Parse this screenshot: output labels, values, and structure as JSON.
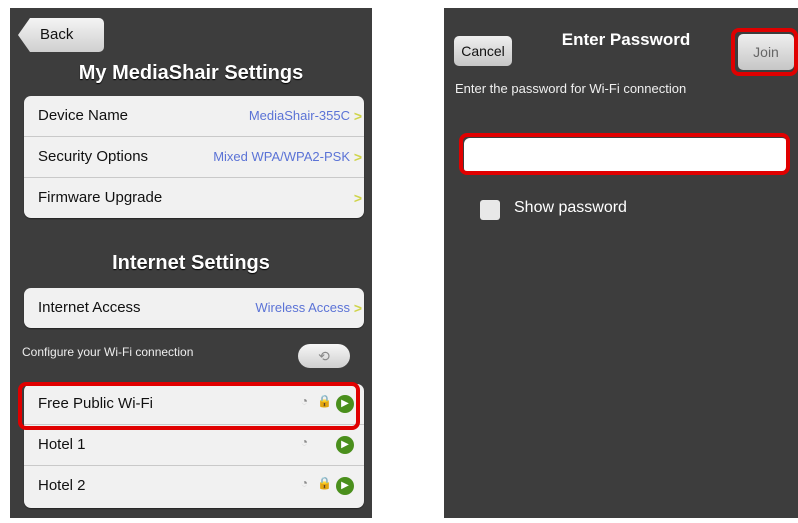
{
  "left": {
    "back_label": "Back",
    "title": "My MediaShair Settings",
    "device_rows": [
      {
        "label": "Device Name",
        "value": "MediaShair-355C",
        "chevron": ">"
      },
      {
        "label": "Security Options",
        "value": "Mixed WPA/WPA2-PSK",
        "chevron": ">"
      },
      {
        "label": "Firmware Upgrade",
        "value": "",
        "chevron": ">"
      }
    ],
    "internet_title": "Internet Settings",
    "internet_access": {
      "label": "Internet Access",
      "value": "Wireless Access",
      "chevron": ">"
    },
    "configure_caption": "Configure your Wi-Fi connection",
    "refresh_icon": "refresh-icon",
    "networks": [
      {
        "name": "Free Public Wi-Fi",
        "secured": true,
        "highlighted": true
      },
      {
        "name": "Hotel 1",
        "secured": false,
        "highlighted": false
      },
      {
        "name": "Hotel 2",
        "secured": true,
        "highlighted": false
      }
    ]
  },
  "right": {
    "cancel_label": "Cancel",
    "title": "Enter Password",
    "join_label": "Join",
    "prompt": "Enter the password for Wi-Fi connection",
    "password_value": "",
    "show_password_label": "Show password",
    "show_password_checked": false
  },
  "colors": {
    "background": "#3d3d3d",
    "cell": "#f1f1f1",
    "value_text": "#5b73d6",
    "highlight": "#e00000",
    "accent_green": "#4a8f1c"
  }
}
